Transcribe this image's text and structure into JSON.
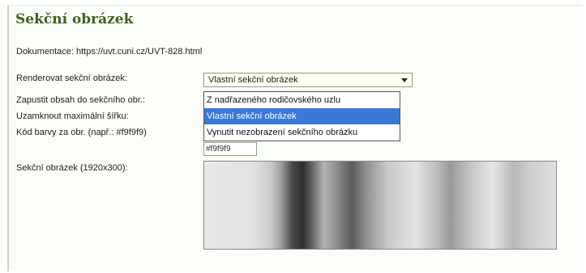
{
  "section": {
    "title": "Sekční obrázek",
    "doc_label": "Dokumentace: https://uvt.cuni.cz/UVT-828.html"
  },
  "fields": {
    "render_label": "Renderovat sekční obrázek:",
    "run_content_label": "Zapustit obsah do sekčního obr.:",
    "lock_width_label": "Uzamknout maximální šířku:",
    "color_label": "Kód barvy za obr. (např.: #f9f9f9)",
    "image_label": "Sekční obrázek (1920x300):"
  },
  "render_select": {
    "value": "Vlastní sekční obrázek",
    "options": [
      "Z nadřazeného rodičovského uzlu",
      "Vlastní sekční obrázek",
      "Vynutit nezobrazení sekčního obrázku"
    ],
    "selected_index": 1
  },
  "color_input": {
    "value": "#f9f9f9"
  },
  "colors": {
    "accent": "#3d6320",
    "selection": "#3c78d8"
  }
}
